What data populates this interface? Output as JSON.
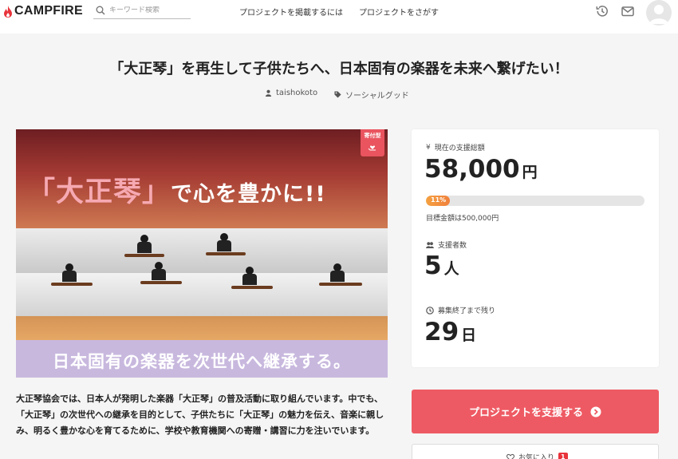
{
  "header": {
    "logo_text": "CAMPFIRE",
    "search_placeholder": "キーワード検索",
    "nav": [
      "プロジェクトを掲載するには",
      "プロジェクトをさがす"
    ]
  },
  "project": {
    "title": "「大正琴」を再生して子供たちへ、日本固有の楽器を未来へ繋げたい！",
    "owner": "taishokoto",
    "category": "ソーシャルグッド",
    "badge": "寄付型",
    "hero_headline_a": "「大正琴」",
    "hero_headline_b": "で心を豊かに!!",
    "hero_subline": "日本固有の楽器を次世代へ継承する。",
    "description": "大正琴協会では、日本人が発明した楽器「大正琴」の普及活動に取り組んでいます。中でも、「大正琴」の次世代への継承を目的として、子供たちに「大正琴」の魅力を伝え、音楽に親しみ、明るく豊かな心を育てるために、学校や教育機関への寄贈・講習に力を注いでいます。"
  },
  "stats": {
    "funded_label": "現在の支援総額",
    "funded_value": "58,000",
    "funded_unit": "円",
    "currency_icon": "¥",
    "progress_percent": 11,
    "progress_label": "11%",
    "goal_text": "目標金額は500,000円",
    "backers_label": "支援者数",
    "backers_value": "5",
    "backers_unit": "人",
    "remaining_label": "募集終了まで残り",
    "remaining_value": "29",
    "remaining_unit": "日"
  },
  "actions": {
    "support_label": "プロジェクトを支援する",
    "favorite_label": "お気に入り",
    "favorite_count": "1"
  },
  "colors": {
    "accent": "#ee5a63",
    "progress": "#f0803c",
    "badge": "#e9545f"
  }
}
